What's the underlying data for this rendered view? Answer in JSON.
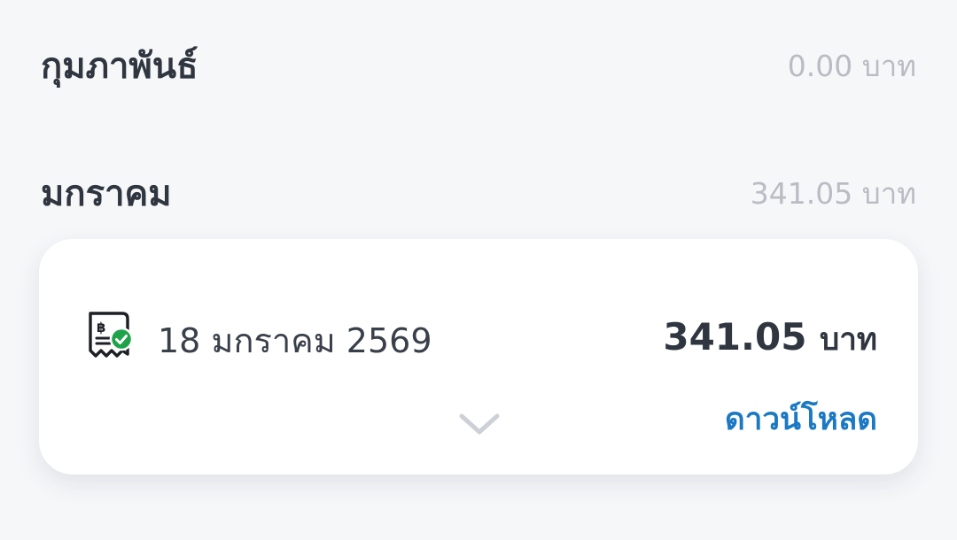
{
  "months": [
    {
      "name": "กุมภาพันธ์",
      "total": "0.00 บาท"
    },
    {
      "name": "มกราคม",
      "total": "341.05 บาท"
    }
  ],
  "bill": {
    "icon": "receipt-paid-icon",
    "date": "18 มกราคม 2569",
    "amount": "341.05",
    "currency": "บาท",
    "download_label": "ดาวน์โหลด",
    "expand_icon": "chevron-down-icon"
  },
  "colors": {
    "background": "#f6f7f9",
    "card": "#ffffff",
    "primary_text": "#2f3640",
    "muted_text": "#b9bcc3",
    "link": "#1a79c2",
    "success": "#1fa34a"
  }
}
